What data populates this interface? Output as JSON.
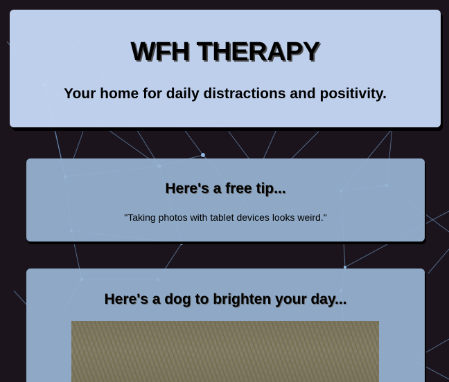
{
  "hero": {
    "title": "WFH THERAPY",
    "subtitle": "Your home for daily distractions and positivity."
  },
  "tip_card": {
    "heading": "Here's a free tip...",
    "tip_text": "\"Taking photos with tablet devices looks weird.\""
  },
  "dog_card": {
    "heading": "Here's a dog to brighten your day..."
  },
  "colors": {
    "background": "#1b141c",
    "hero_card": "#c4d6f4",
    "content_card": "#97b4d2",
    "network_lines": "#7fb3e8"
  }
}
